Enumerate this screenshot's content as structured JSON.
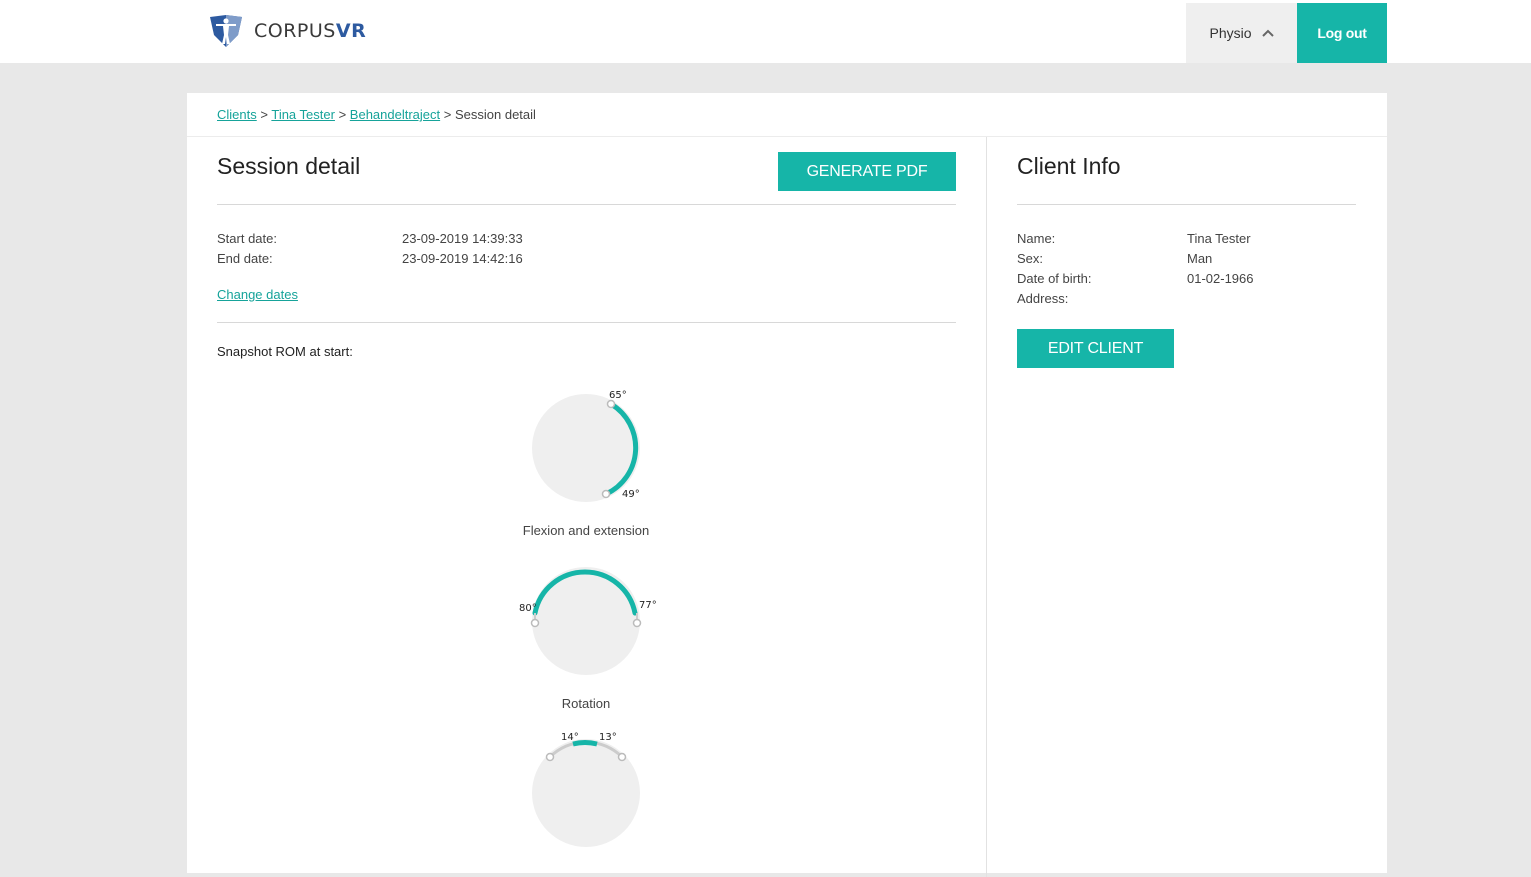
{
  "header": {
    "logo_text_main": "CORPUS",
    "logo_text_accent": "VR",
    "user_label": "Physio",
    "logout_label": "Log out"
  },
  "breadcrumb": {
    "items": [
      "Clients",
      "Tina Tester",
      "Behandeltraject"
    ],
    "current": "Session detail",
    "separator": ">"
  },
  "session": {
    "title": "Session detail",
    "generate_pdf_label": "GENERATE PDF",
    "start_label": "Start date:",
    "start_value": "23-09-2019 14:39:33",
    "end_label": "End date:",
    "end_value": "23-09-2019 14:42:16",
    "change_dates_label": "Change dates",
    "snapshot_label": "Snapshot ROM at start:"
  },
  "gauges": [
    {
      "name": "Flexion and extension",
      "label_a": "65°",
      "label_b": "49°"
    },
    {
      "name": "Rotation",
      "label_a": "80°",
      "label_b": "77°"
    },
    {
      "name": "",
      "label_a": "14°",
      "label_b": "13°"
    }
  ],
  "client": {
    "title": "Client Info",
    "fields": [
      {
        "label": "Name:",
        "value": "Tina Tester"
      },
      {
        "label": "Sex:",
        "value": "Man"
      },
      {
        "label": "Date of birth:",
        "value": "01-02-1966"
      },
      {
        "label": "Address:",
        "value": ""
      }
    ],
    "edit_label": "EDIT CLIENT"
  },
  "colors": {
    "accent": "#16b5a8",
    "link": "#16a39a",
    "gauge_fill": "#efefef",
    "gauge_track": "#cccccc"
  }
}
